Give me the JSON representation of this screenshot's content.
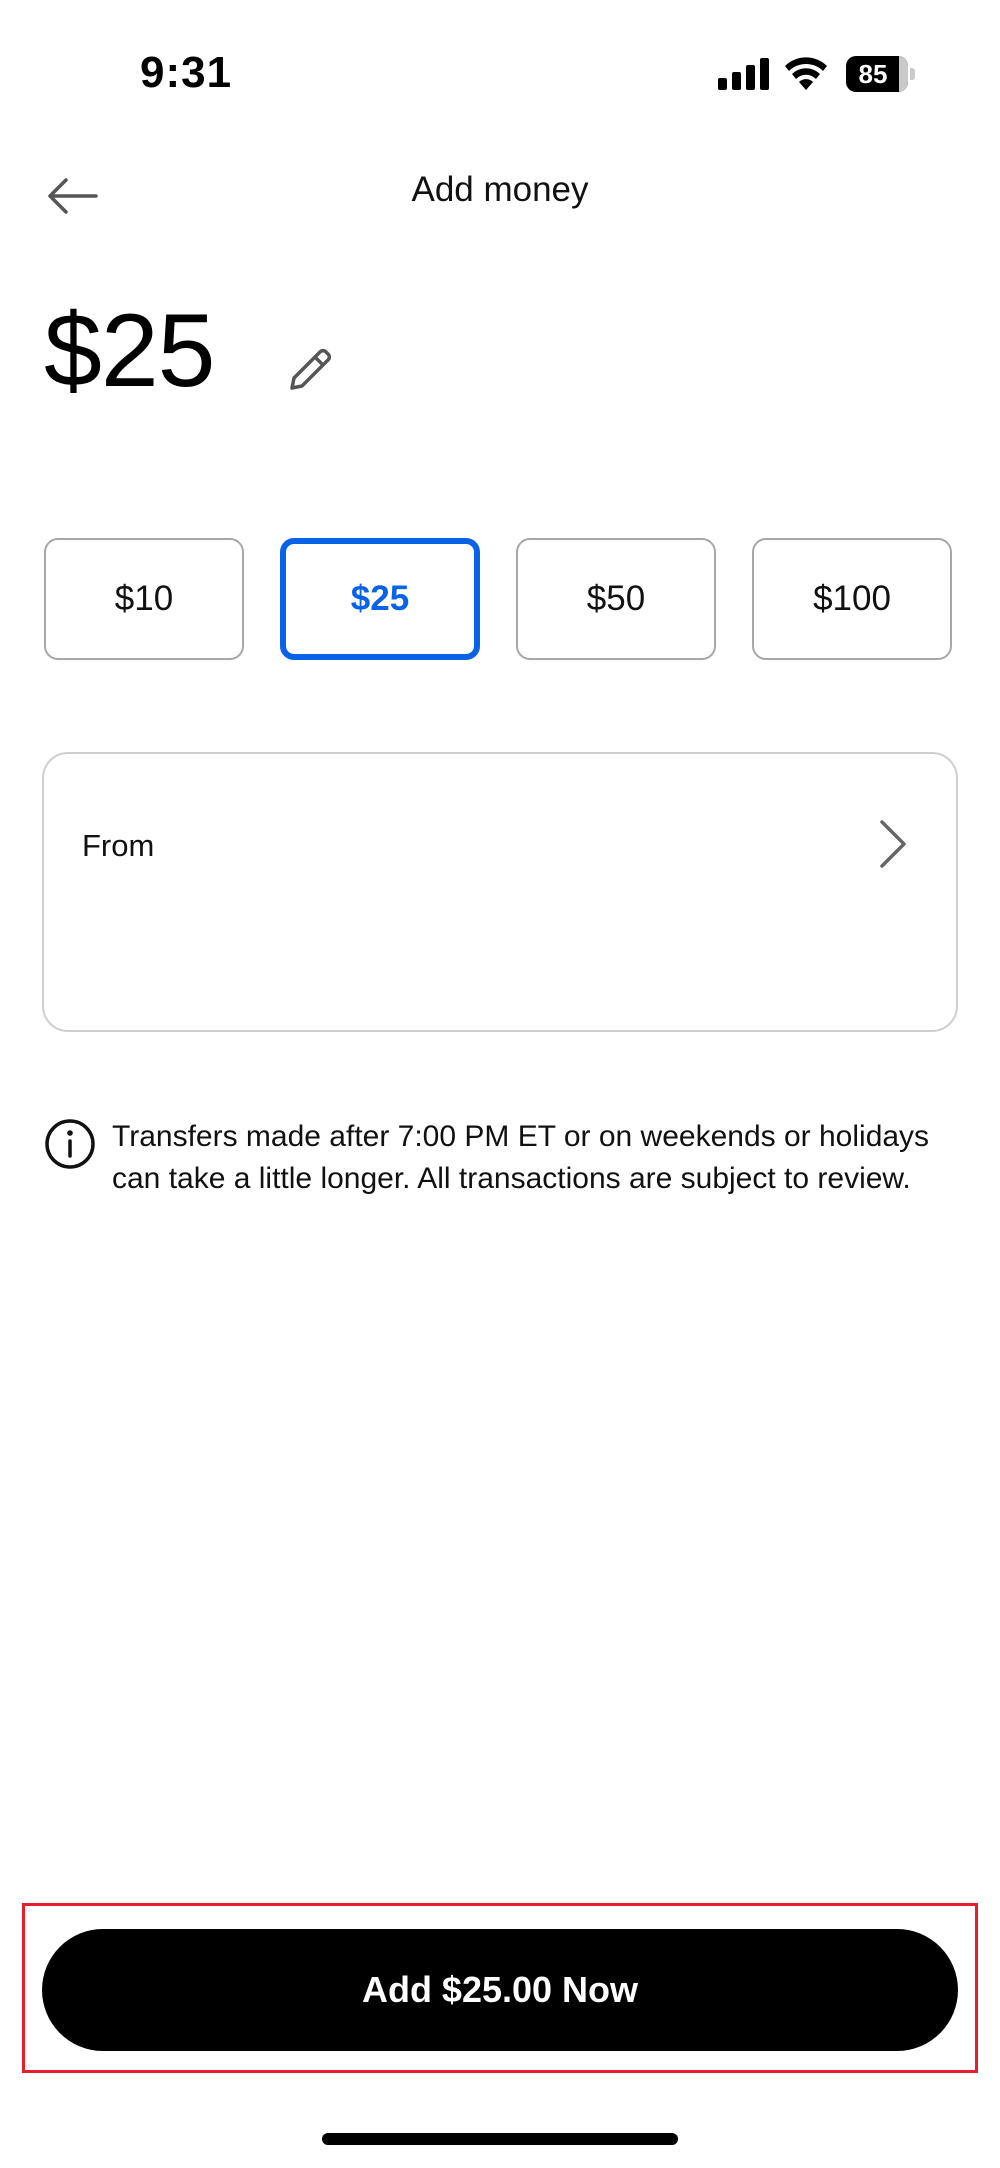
{
  "status_bar": {
    "time": "9:31",
    "battery_level": "85",
    "battery_fraction": 0.85,
    "icons": [
      "cellular-signal-icon",
      "wifi-icon",
      "battery-icon"
    ]
  },
  "header": {
    "title": "Add money",
    "back_icon": "arrow-left-icon"
  },
  "amount": {
    "value": "$25",
    "edit_icon": "pencil-icon"
  },
  "presets": [
    {
      "label": "$10",
      "selected": false
    },
    {
      "label": "$25",
      "selected": true
    },
    {
      "label": "$50",
      "selected": false
    },
    {
      "label": "$100",
      "selected": false
    }
  ],
  "from": {
    "label": "From",
    "icon": "chevron-right-icon"
  },
  "info": {
    "icon": "info-icon",
    "text": "Transfers made after 7:00 PM ET or on weekends or holidays can take a little longer. All transactions are subject to review."
  },
  "cta": {
    "label": "Add $25.00 Now"
  },
  "colors": {
    "accent": "#0a63e6",
    "highlight": "#e5202a",
    "button_bg": "#000000",
    "border": "#a7a7a7"
  }
}
